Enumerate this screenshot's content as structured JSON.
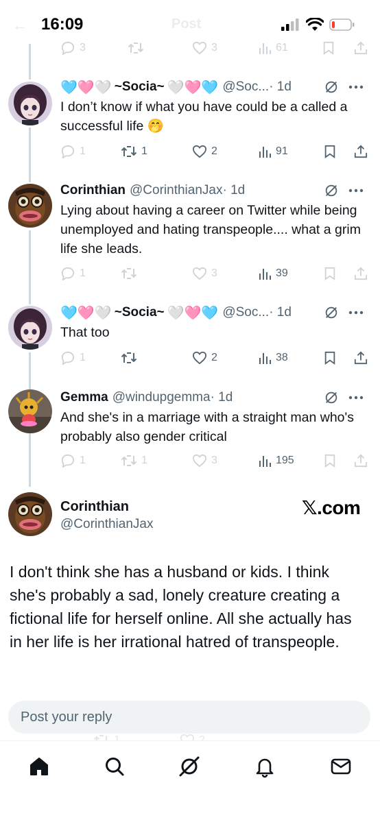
{
  "status_bar": {
    "time": "16:09",
    "ghost_title": "Post"
  },
  "thread": [
    {
      "id": "t0",
      "actions": {
        "reply": "3",
        "repost": "",
        "like": "3",
        "views": "61"
      }
    },
    {
      "id": "t1",
      "display_name": "~Socia~",
      "name_emoji_left": "🩵🩷🤍",
      "name_emoji_right": "🤍🩷🩵",
      "handle": "@Soc...",
      "time": "· 1d",
      "text": "I don’t know if what you have could be a called a successful life 🤭",
      "actions": {
        "reply": "1",
        "repost": "1",
        "like": "2",
        "views": "91"
      },
      "faded": false
    },
    {
      "id": "t2",
      "display_name": "Corinthian",
      "handle": "@CorinthianJax",
      "time": "· 1d",
      "text": "Lying about having a career on Twitter while being unemployed and hating transpeople.... what a grim life she leads.",
      "actions": {
        "reply": "1",
        "repost": "",
        "like": "3",
        "views": "39"
      },
      "faded": true
    },
    {
      "id": "t3",
      "display_name": "~Socia~",
      "name_emoji_left": "🩵🩷🤍",
      "name_emoji_right": "🤍🩷🩵",
      "handle": "@Soc...",
      "time": "· 1d",
      "text": "That too",
      "actions": {
        "reply": "1",
        "repost": "",
        "like": "2",
        "views": "38"
      },
      "faded": false
    },
    {
      "id": "t4",
      "display_name": "Gemma",
      "handle": "@windupgemma",
      "time": "· 1d",
      "text": "And she's in a marriage with a straight man who's probably also gender critical",
      "actions": {
        "reply": "1",
        "repost": "1",
        "like": "3",
        "views": "195"
      },
      "faded": true
    }
  ],
  "main_post": {
    "display_name": "Corinthian",
    "handle": "@CorinthianJax",
    "watermark": "𝕏.com",
    "text": "I don't think she has a husband or kids. I think she's probably a sad, lonely creature creating a fictional life for herself online. All she actually has in her life is her irrational hatred of transpeople."
  },
  "reply_bar": {
    "placeholder": "Post your reply"
  },
  "ghost_row": {
    "repost": "1",
    "like": "2"
  },
  "bottom_nav": [
    {
      "name": "home-icon",
      "active": true
    },
    {
      "name": "search-icon",
      "active": false
    },
    {
      "name": "grok-icon",
      "active": false
    },
    {
      "name": "notifications-icon",
      "active": false
    },
    {
      "name": "messages-icon",
      "active": false
    }
  ],
  "colors": {
    "text": "#0f1419",
    "secondary": "#536471",
    "thread_line": "#cfd9de",
    "reply_bg": "#eff3f4",
    "battery_red": "#ff3b30"
  }
}
